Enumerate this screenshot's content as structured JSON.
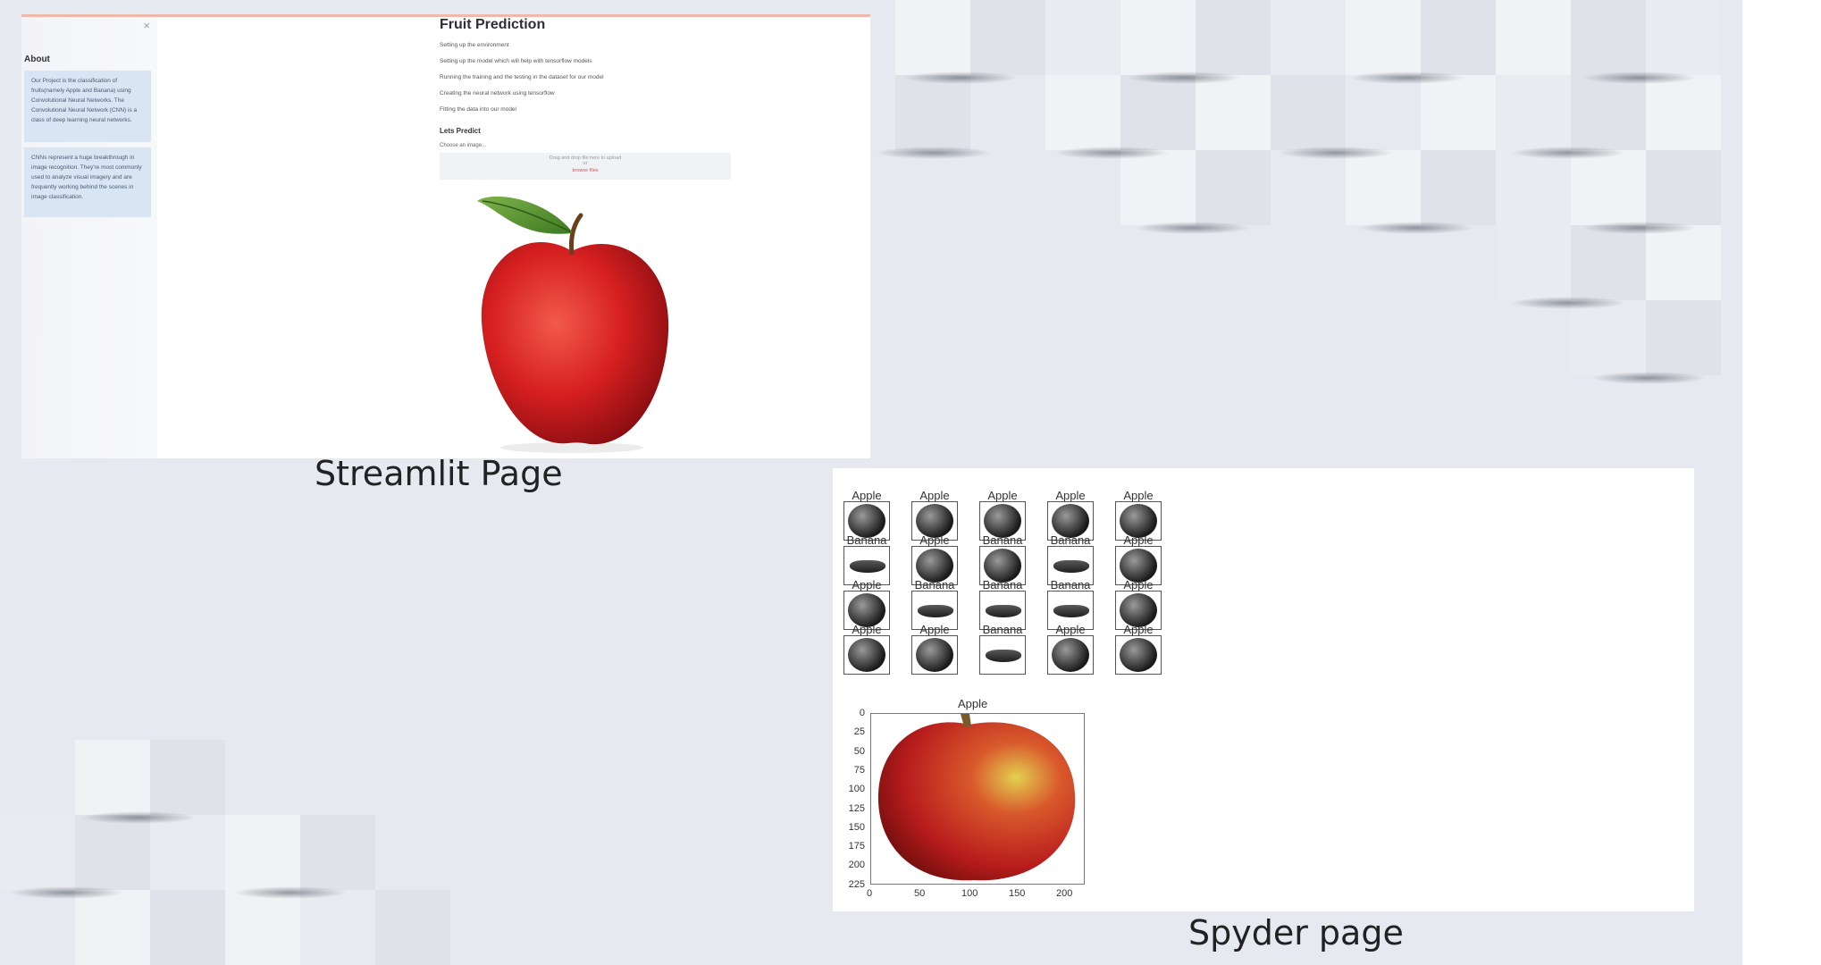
{
  "streamlit": {
    "caption": "Streamlit Page",
    "close_glyph": "×",
    "sidebar": {
      "about_title": "About",
      "card1": "Our Project is the classification of fruits(namely Apple and Banana) using Convolutional Neural Networks. The Convolutional Neural Network (CNN) is a class of deep learning neural networks.",
      "card2": "CNNs represent a huge breakthrough in image recognition. They're most commonly used to analyze visual imagery and are frequently working behind the scenes in image classification."
    },
    "main": {
      "title": "Fruit Prediction",
      "steps": [
        "Setting up the environment",
        "Setting up the model which will help with tensorflow models",
        "Running the training and the testing in the dataset for our model",
        "Creating the neural network using tensorflow",
        "Fitting the data into our model"
      ],
      "subheading": "Lets Predict",
      "choose_label": "Choose an image...",
      "upload_hint": "Drag and drop file here to upload",
      "upload_or": "or",
      "upload_button": "browse files"
    }
  },
  "spyder": {
    "caption": "Spyder page",
    "grid_labels": [
      [
        "Apple",
        "Apple",
        "Apple",
        "Apple",
        "Apple"
      ],
      [
        "Banana",
        "Apple",
        "Banana",
        "Banana",
        "Apple"
      ],
      [
        "Apple",
        "Banana",
        "Banana",
        "Banana",
        "Apple"
      ],
      [
        "Apple",
        "Apple",
        "Banana",
        "Apple",
        "Apple"
      ]
    ],
    "grid_kinds": [
      [
        "apple",
        "apple",
        "apple",
        "apple",
        "apple"
      ],
      [
        "banana",
        "apple",
        "apple",
        "banana",
        "apple"
      ],
      [
        "apple",
        "banana",
        "banana",
        "banana",
        "apple"
      ],
      [
        "apple",
        "apple",
        "banana",
        "apple",
        "apple"
      ]
    ],
    "big_title": "Apple",
    "y_ticks": [
      "0",
      "25",
      "50",
      "75",
      "100",
      "125",
      "150",
      "175",
      "200",
      "225"
    ],
    "x_ticks": [
      "0",
      "50",
      "100",
      "150",
      "200"
    ]
  }
}
